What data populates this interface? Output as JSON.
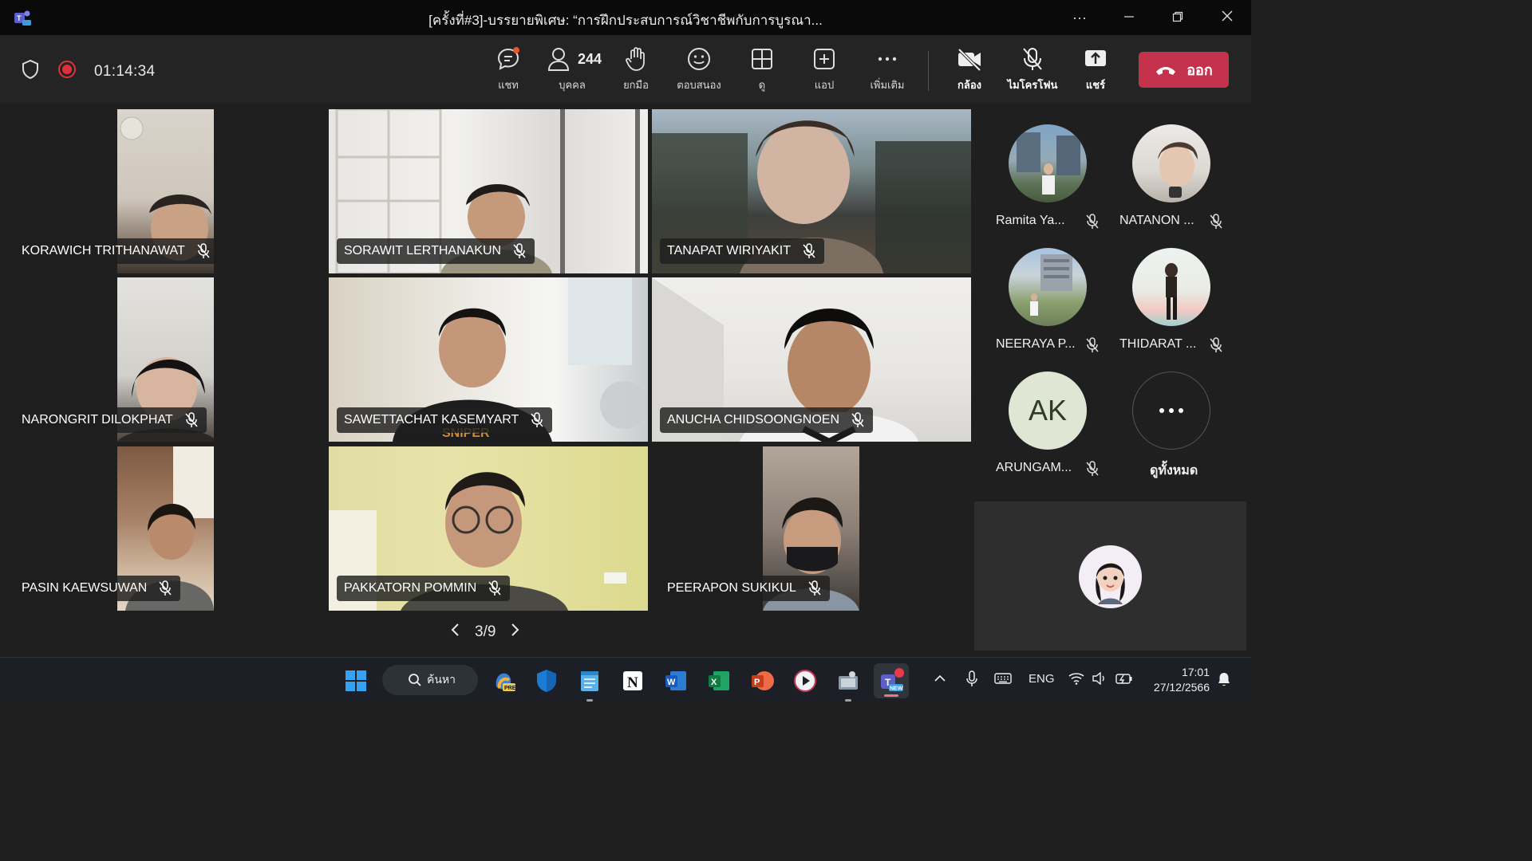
{
  "window": {
    "title": "[ครั้งที่#3]-บรรยายพิเศษ: “การฝึกประสบการณ์วิชาชีพกับการบูรณา...",
    "more_label": "···"
  },
  "toolbar": {
    "timer": "01:14:34",
    "chat_label": "แชท",
    "people_count": "244",
    "people_label": "บุคคล",
    "raise_label": "ยกมือ",
    "react_label": "ตอบสนอง",
    "view_label": "ดู",
    "apps_label": "แอป",
    "more_label": "เพิ่มเติม",
    "camera_label": "กล้อง",
    "mic_label": "ไมโครโฟน",
    "share_label": "แชร์",
    "leave_label": "ออก"
  },
  "tiles": [
    {
      "name": "KORAWICH TRITHANAWAT"
    },
    {
      "name": "SORAWIT LERTHANAKUN"
    },
    {
      "name": "TANAPAT WIRIYAKIT"
    },
    {
      "name": "NARONGRIT DILOKPHAT"
    },
    {
      "name": "SAWETTACHAT KASEMYART"
    },
    {
      "name": "ANUCHA CHIDSOONGNOEN"
    },
    {
      "name": "PASIN KAEWSUWAN"
    },
    {
      "name": "PAKKATORN POMMIN"
    },
    {
      "name": "PEERAPON SUKIKUL"
    }
  ],
  "pager": {
    "text": "3/9"
  },
  "side_people": [
    {
      "name": "Ramita Ya..."
    },
    {
      "name": "NATANON ..."
    },
    {
      "name": "NEERAYA P..."
    },
    {
      "name": "THIDARAT ..."
    },
    {
      "name": "ARUNGAM...",
      "initials": "AK"
    },
    {
      "name": "ดูทั้งหมด"
    }
  ],
  "taskbar": {
    "search_label": "ค้นหา",
    "language": "ENG",
    "time": "17:01",
    "date": "27/12/2566"
  },
  "colors": {
    "leave": "#c4314b",
    "record": "#e0313a",
    "background": "#1f1f1f"
  }
}
